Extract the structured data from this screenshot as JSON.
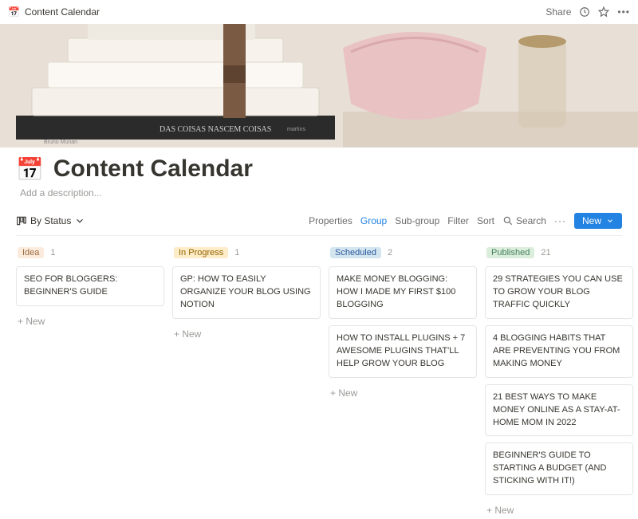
{
  "topbar": {
    "icon": "📅",
    "title": "Content Calendar",
    "share": "Share"
  },
  "page": {
    "icon": "📅",
    "title": "Content Calendar",
    "description_placeholder": "Add a description..."
  },
  "view": {
    "name": "By Status"
  },
  "toolbar": {
    "properties": "Properties",
    "group": "Group",
    "subgroup": "Sub-group",
    "filter": "Filter",
    "sort": "Sort",
    "search": "Search",
    "new": "New"
  },
  "columns": [
    {
      "tag": "Idea",
      "tag_class": "tag-idea",
      "count": "1",
      "cards": [
        "SEO FOR BLOGGERS: BEGINNER'S GUIDE"
      ]
    },
    {
      "tag": "In Progress",
      "tag_class": "tag-prog",
      "count": "1",
      "cards": [
        "GP: HOW TO EASILY ORGANIZE YOUR BLOG USING NOTION"
      ]
    },
    {
      "tag": "Scheduled",
      "tag_class": "tag-sched",
      "count": "2",
      "cards": [
        "MAKE MONEY BLOGGING: HOW I MADE MY FIRST $100 BLOGGING",
        "HOW TO INSTALL PLUGINS + 7 AWESOME PLUGINS THAT'LL HELP GROW YOUR BLOG"
      ]
    },
    {
      "tag": "Published",
      "tag_class": "tag-pub",
      "count": "21",
      "cards": [
        "29 STRATEGIES YOU CAN USE TO GROW YOUR BLOG TRAFFIC QUICKLY",
        "4 BLOGGING HABITS THAT ARE PREVENTING YOU FROM MAKING MONEY",
        "21 BEST WAYS TO MAKE MONEY ONLINE AS A STAY-AT-HOME MOM IN 2022",
        "BEGINNER'S GUIDE TO STARTING A BUDGET (AND STICKING WITH IT!)"
      ]
    }
  ],
  "add_new_label": "+  New"
}
